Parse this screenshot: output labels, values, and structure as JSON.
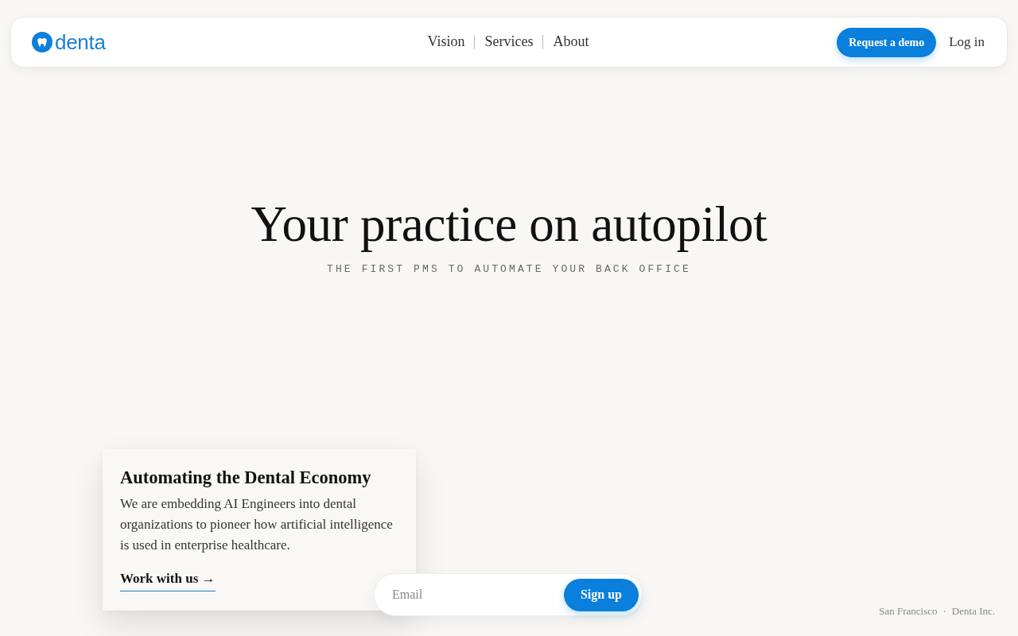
{
  "nav": {
    "logo": "denta",
    "links": [
      "Vision",
      "Services",
      "About"
    ],
    "cta": "Request a demo",
    "login": "Log in"
  },
  "hero": {
    "title": "Your practice on autopilot",
    "subtitle": "THE FIRST PMS TO AUTOMATE YOUR BACK OFFICE"
  },
  "card": {
    "title": "Automating the Dental Economy",
    "body": "We are embedding AI Engineers into dental organizations to pioneer how artificial intelligence is used in enterprise healthcare.",
    "link": "Work with us →"
  },
  "signup": {
    "placeholder": "Email",
    "button": "Sign up"
  },
  "footer": {
    "location": "San Francisco",
    "separator": "·",
    "company": "Denta Inc."
  }
}
